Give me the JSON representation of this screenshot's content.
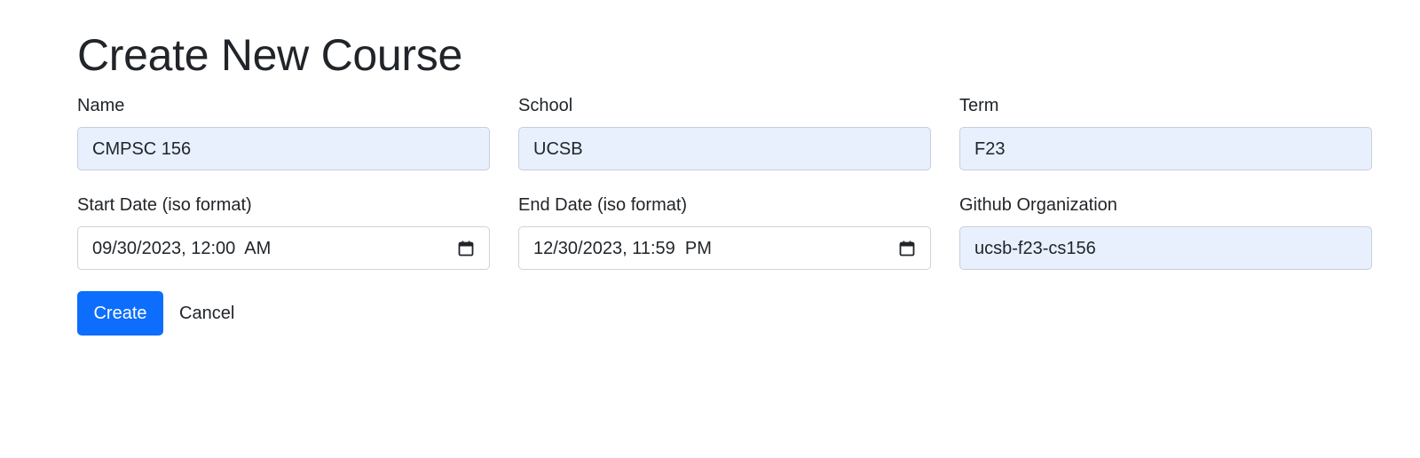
{
  "page": {
    "title": "Create New Course"
  },
  "form": {
    "name": {
      "label": "Name",
      "value": "CMPSC 156"
    },
    "school": {
      "label": "School",
      "value": "UCSB"
    },
    "term": {
      "label": "Term",
      "value": "F23"
    },
    "start_date": {
      "label": "Start Date (iso format)",
      "value": "09/30/2023, 12:00  AM",
      "icon": "calendar-icon"
    },
    "end_date": {
      "label": "End Date (iso format)",
      "value": "12/30/2023, 11:59  PM",
      "icon": "calendar-icon"
    },
    "github_org": {
      "label": "Github Organization",
      "value": "ucsb-f23-cs156"
    }
  },
  "buttons": {
    "create_label": "Create",
    "cancel_label": "Cancel"
  },
  "colors": {
    "primary": "#0d6efd",
    "autofill_bg": "#e8f0fe",
    "text": "#212529",
    "border": "#ced4da"
  }
}
